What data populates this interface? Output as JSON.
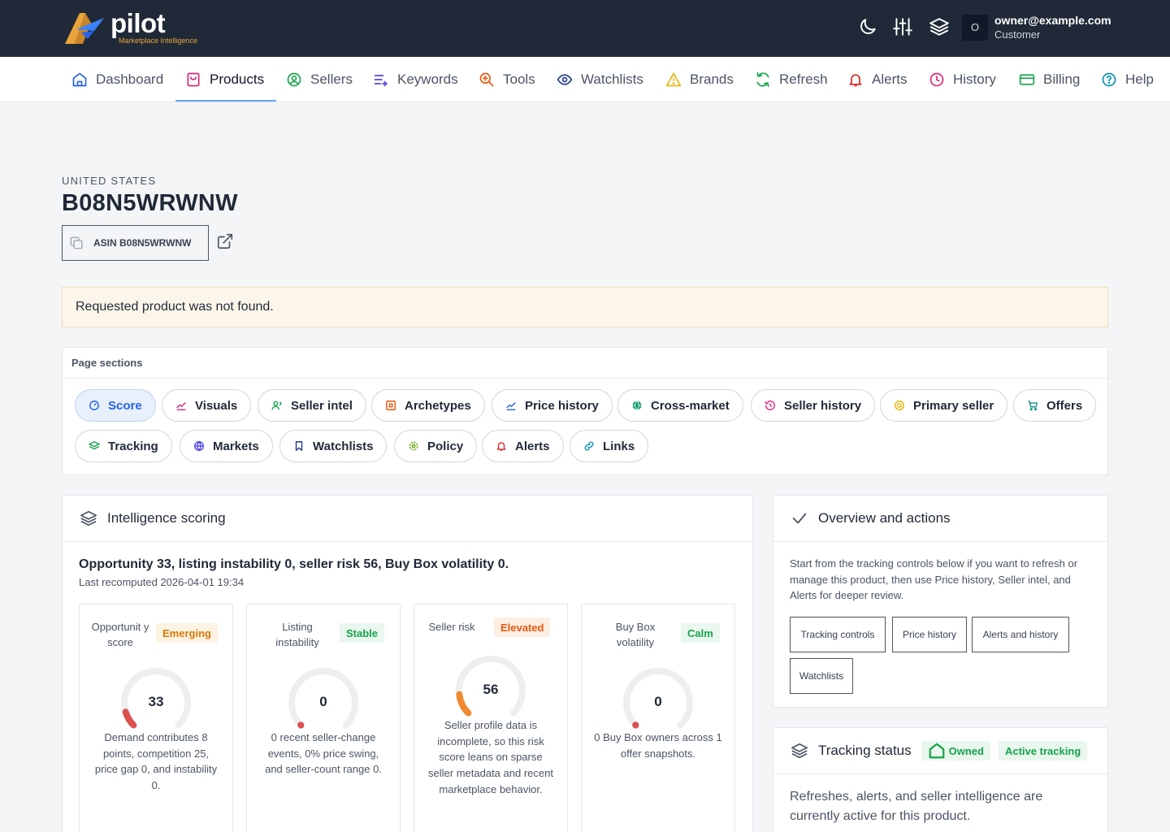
{
  "app": {
    "logo_name": "pilot",
    "logo_tagline": "Marketplace Intelligence",
    "user_initial": "O",
    "user_email": "owner@example.com",
    "user_role": "Customer"
  },
  "nav": [
    {
      "label": "Dashboard",
      "icon": "home-icon"
    },
    {
      "label": "Products",
      "icon": "bag-icon",
      "active": true
    },
    {
      "label": "Sellers",
      "icon": "user-circle-icon"
    },
    {
      "label": "Keywords",
      "icon": "list-arrow-icon"
    },
    {
      "label": "Tools",
      "icon": "zoom-plus-icon"
    },
    {
      "label": "Watchlists",
      "icon": "eye-icon"
    },
    {
      "label": "Brands",
      "icon": "warning-icon"
    },
    {
      "label": "Refresh",
      "icon": "refresh-icon"
    },
    {
      "label": "Alerts",
      "icon": "bell-icon"
    },
    {
      "label": "History",
      "icon": "clock-icon"
    },
    {
      "label": "Billing",
      "icon": "credit-card-icon"
    },
    {
      "label": "Help",
      "icon": "help-circle-icon"
    }
  ],
  "product": {
    "country": "UNITED STATES",
    "asin": "B08N5WRWNW",
    "asin_chip": "ASIN B08N5WRWNW"
  },
  "alert_message": "Requested product was not found.",
  "sections": {
    "title": "Page sections",
    "pills": [
      {
        "label": "Score",
        "color": "#2563eb"
      },
      {
        "label": "Visuals",
        "color": "#db2777"
      },
      {
        "label": "Seller intel",
        "color": "#16a34a"
      },
      {
        "label": "Archetypes",
        "color": "#ea580c"
      },
      {
        "label": "Price history",
        "color": "#2563eb"
      },
      {
        "label": "Cross-market",
        "color": "#059669"
      },
      {
        "label": "Seller history",
        "color": "#db2777"
      },
      {
        "label": "Primary seller",
        "color": "#eab308"
      },
      {
        "label": "Offers",
        "color": "#0d9488"
      },
      {
        "label": "Tracking",
        "color": "#16a34a"
      },
      {
        "label": "Markets",
        "color": "#4f46e5"
      },
      {
        "label": "Watchlists",
        "color": "#1e3a8a"
      },
      {
        "label": "Policy",
        "color": "#65a30d"
      },
      {
        "label": "Alerts",
        "color": "#dc2626"
      },
      {
        "label": "Links",
        "color": "#0891b2"
      }
    ]
  },
  "scoring": {
    "title": "Intelligence scoring",
    "summary": "Opportunity 33, listing instability 0, seller risk 56, Buy Box volatility 0.",
    "recomputed": "Last recomputed 2026-04-01 19:34",
    "metrics": [
      {
        "label": "Opportunit y score",
        "badge": "Emerging",
        "badge_color": "#d97706",
        "badge_bg": "#fdf3e3",
        "value": 33,
        "gauge_color": "#dc5050",
        "desc": "Demand contributes 8 points, competition 25, price gap 0, and instability 0."
      },
      {
        "label": "Listing instability",
        "badge": "Stable",
        "badge_color": "#16a34a",
        "badge_bg": "#e9f7ee",
        "value": 0,
        "gauge_color": "#dc5050",
        "desc": "0 recent seller-change events, 0% price swing, and seller-count range 0."
      },
      {
        "label": "Seller risk",
        "badge": "Elevated",
        "badge_color": "#ea580c",
        "badge_bg": "#fdeee4",
        "value": 56,
        "gauge_color": "#f08a30",
        "desc": "Seller profile data is incomplete, so this risk score leans on sparse seller metadata and recent marketplace behavior."
      },
      {
        "label": "Buy Box volatility",
        "badge": "Calm",
        "badge_color": "#16a34a",
        "badge_bg": "#e9f7ee",
        "value": 0,
        "gauge_color": "#dc5050",
        "desc": "0 Buy Box owners across 1 offer snapshots."
      }
    ]
  },
  "overview": {
    "title": "Overview and actions",
    "text": "Start from the tracking controls below if you want to refresh or manage this product, then use Price history, Seller intel, and Alerts for deeper review.",
    "buttons": [
      "Tracking controls",
      "Price history",
      "Alerts and history",
      "Watchlists"
    ]
  },
  "tracking": {
    "title": "Tracking status",
    "badge_owned": "Owned",
    "badge_active": "Active tracking",
    "text": "Refreshes, alerts, and seller intelligence are currently active for this product."
  }
}
